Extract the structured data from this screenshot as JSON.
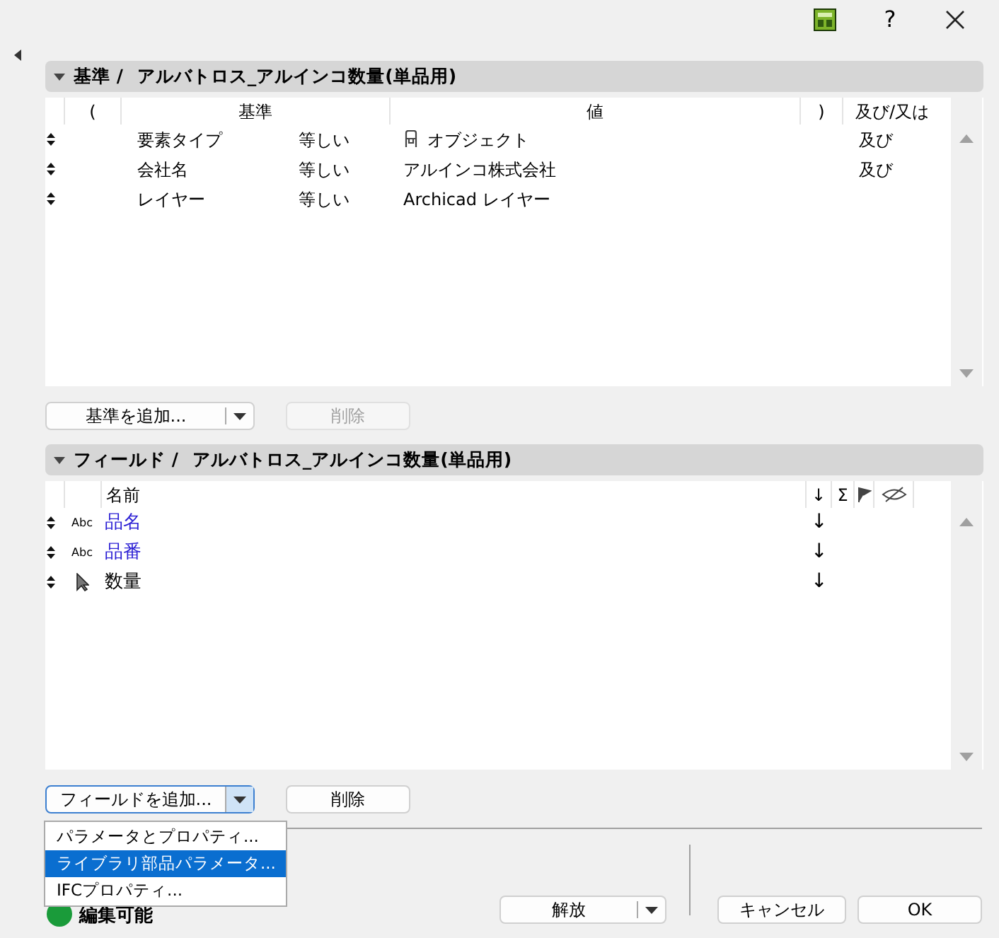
{
  "title_bar": {
    "help": "?"
  },
  "criteria_section": {
    "expanded": true,
    "label": "基準 /",
    "name": "アルバトロス_アルインコ数量(単品用)",
    "columns": [
      "(",
      "基準",
      "値",
      ")",
      "及び/又は"
    ],
    "rows": [
      {
        "criterion": "要素タイプ",
        "operator": "等しい",
        "kind": "element-type",
        "value": "オブジェクト",
        "and_or": "及び"
      },
      {
        "criterion": "会社名",
        "operator": "等しい",
        "kind": "text",
        "value": "アルインコ株式会社",
        "and_or": "及び"
      },
      {
        "criterion": "レイヤー",
        "operator": "等しい",
        "kind": "text",
        "value": "Archicad レイヤー"
      }
    ],
    "add_button": {
      "label": "基準を追加..."
    },
    "delete_button": {
      "label": "削除",
      "disabled": true
    }
  },
  "fields_section": {
    "expanded": true,
    "label": "フィールド /",
    "name": "アルバトロス_アルインコ数量(単品用)",
    "columns": [
      "名前",
      "↓",
      "Σ"
    ],
    "rows": [
      {
        "kind": "text",
        "type_label": "Abc",
        "name": "品名",
        "color": "#2b1fd4",
        "sort": "↓"
      },
      {
        "kind": "text",
        "type_label": "Abc",
        "name": "品番",
        "color": "#2b1fd4",
        "sort": "↓"
      },
      {
        "kind": "pointer",
        "name": "数量",
        "color": "#000000",
        "sort": "↓"
      }
    ],
    "add_button": {
      "label": "フィールドを追加...",
      "expanded": true
    },
    "delete_button": {
      "label": "削除",
      "disabled": false
    },
    "menu": [
      {
        "label": "パラメータとプロパティ...",
        "selected": false
      },
      {
        "label": "ライブラリ部品パラメータ...",
        "selected": true
      },
      {
        "label": "IFCプロパティ...",
        "selected": false
      }
    ]
  },
  "footer": {
    "status": "編集可能",
    "release_button": "解放",
    "cancel_button": "キャンセル",
    "ok_button": "OK"
  }
}
